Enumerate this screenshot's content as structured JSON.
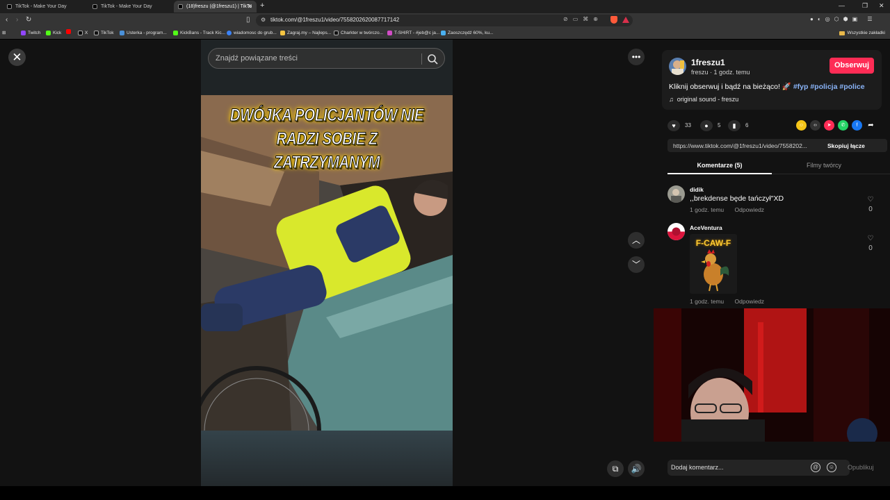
{
  "browser": {
    "tabs": [
      {
        "label": "TikTok - Make Your Day"
      },
      {
        "label": "TikTok - Make Your Day"
      },
      {
        "label": "(18)freszu (@1freszu1) | TikTo"
      }
    ],
    "url": "tiktok.com/@1freszu1/video/7558202620087717142",
    "bookmarks": [
      {
        "label": "Twitch"
      },
      {
        "label": "Kick"
      },
      {
        "label": "X"
      },
      {
        "label": "TikTok"
      },
      {
        "label": "Usterka - program..."
      },
      {
        "label": "KickBans - Track Kic..."
      },
      {
        "label": "wiadomosc do grub..."
      },
      {
        "label": "Zagraj.my – Najleps..."
      },
      {
        "label": "Charkter w twórczo..."
      },
      {
        "label": "T-SHIRT - #jeb@c ja..."
      },
      {
        "label": "Zaoszczędź 60%, ku..."
      }
    ],
    "all_bookmarks": "Wszystkie zakładki"
  },
  "video": {
    "search_placeholder": "Znajdź powiązane treści",
    "title_line1": "DWÓJKA POLICJANTÓW NIE",
    "title_line2": "RADZI SOBIE Z ZATRZYMANYM"
  },
  "post": {
    "author": "1freszu1",
    "author_sub": "freszu · 1 godz. temu",
    "follow_label": "Obserwuj",
    "desc_text": "Kliknij obserwuj i bądź na bieżąco! 🚀 ",
    "hashtags": [
      "#fyp",
      "#policja",
      "#police"
    ],
    "sound": "original sound - freszu",
    "likes": "33",
    "comments": "5",
    "saves": "6",
    "link": "https://www.tiktok.com/@1freszu1/video/7558202...",
    "copy_label": "Skopiuj łącze",
    "tab_comments": "Komentarze (5)",
    "tab_creator": "Filmy twórcy"
  },
  "comments": [
    {
      "user": "didik",
      "text": ",,brekdense będe tańczył\"XD",
      "time": "1 godz. temu",
      "reply": "Odpowiedz",
      "likes": "0"
    },
    {
      "user": "AceVentura",
      "text": "F-CAW-F",
      "time": "1 godz. temu",
      "reply": "Odpowiedz",
      "likes": "0"
    }
  ],
  "composer": {
    "placeholder": "Dodaj komentarz...",
    "publish": "Opublikuj"
  },
  "colors": {
    "accent": "#fe2c55",
    "hashtag": "#8ab4f8",
    "panel_bg": "#121212"
  }
}
